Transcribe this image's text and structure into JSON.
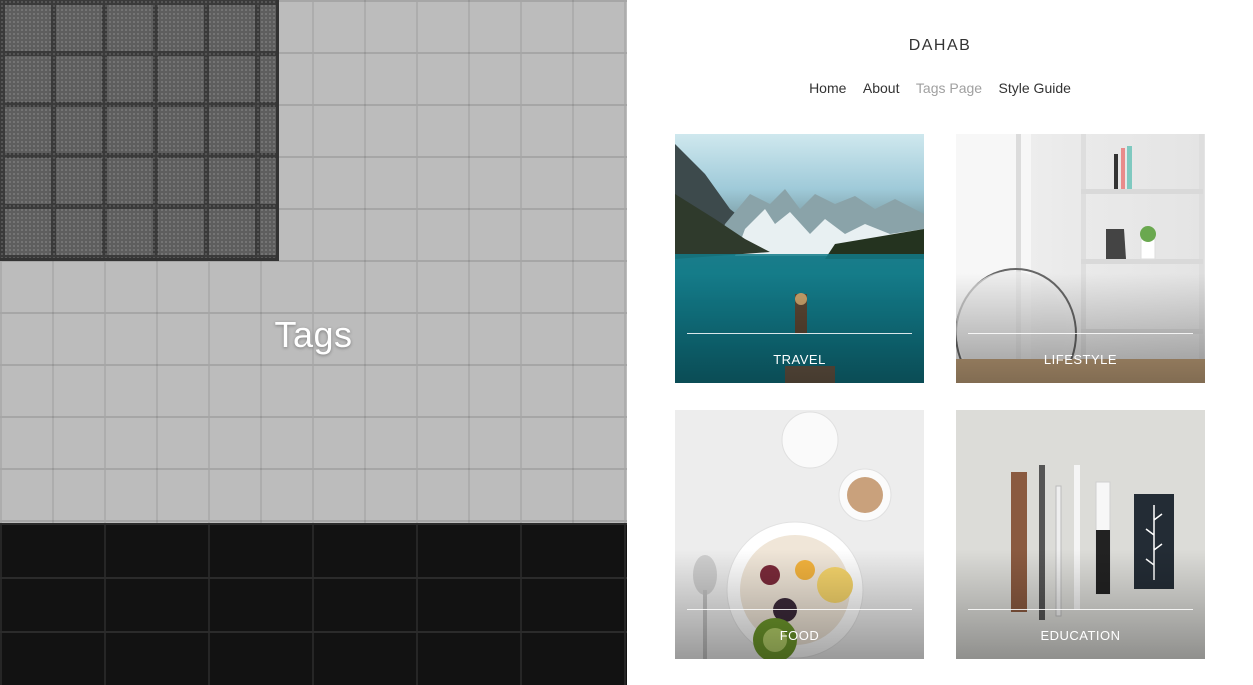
{
  "hero": {
    "title": "Tags"
  },
  "site": {
    "brand": "DAHAB"
  },
  "nav": {
    "items": [
      {
        "label": "Home"
      },
      {
        "label": "About"
      },
      {
        "label": "Tags Page"
      },
      {
        "label": "Style Guide"
      }
    ],
    "active": "Tags Page"
  },
  "tags": [
    {
      "label": "TRAVEL"
    },
    {
      "label": "LIFESTYLE"
    },
    {
      "label": "FOOD"
    },
    {
      "label": "EDUCATION"
    }
  ],
  "colors": {
    "text": "#333333",
    "nav_active": "#a0a0a0",
    "overlay_text": "#ffffff"
  }
}
